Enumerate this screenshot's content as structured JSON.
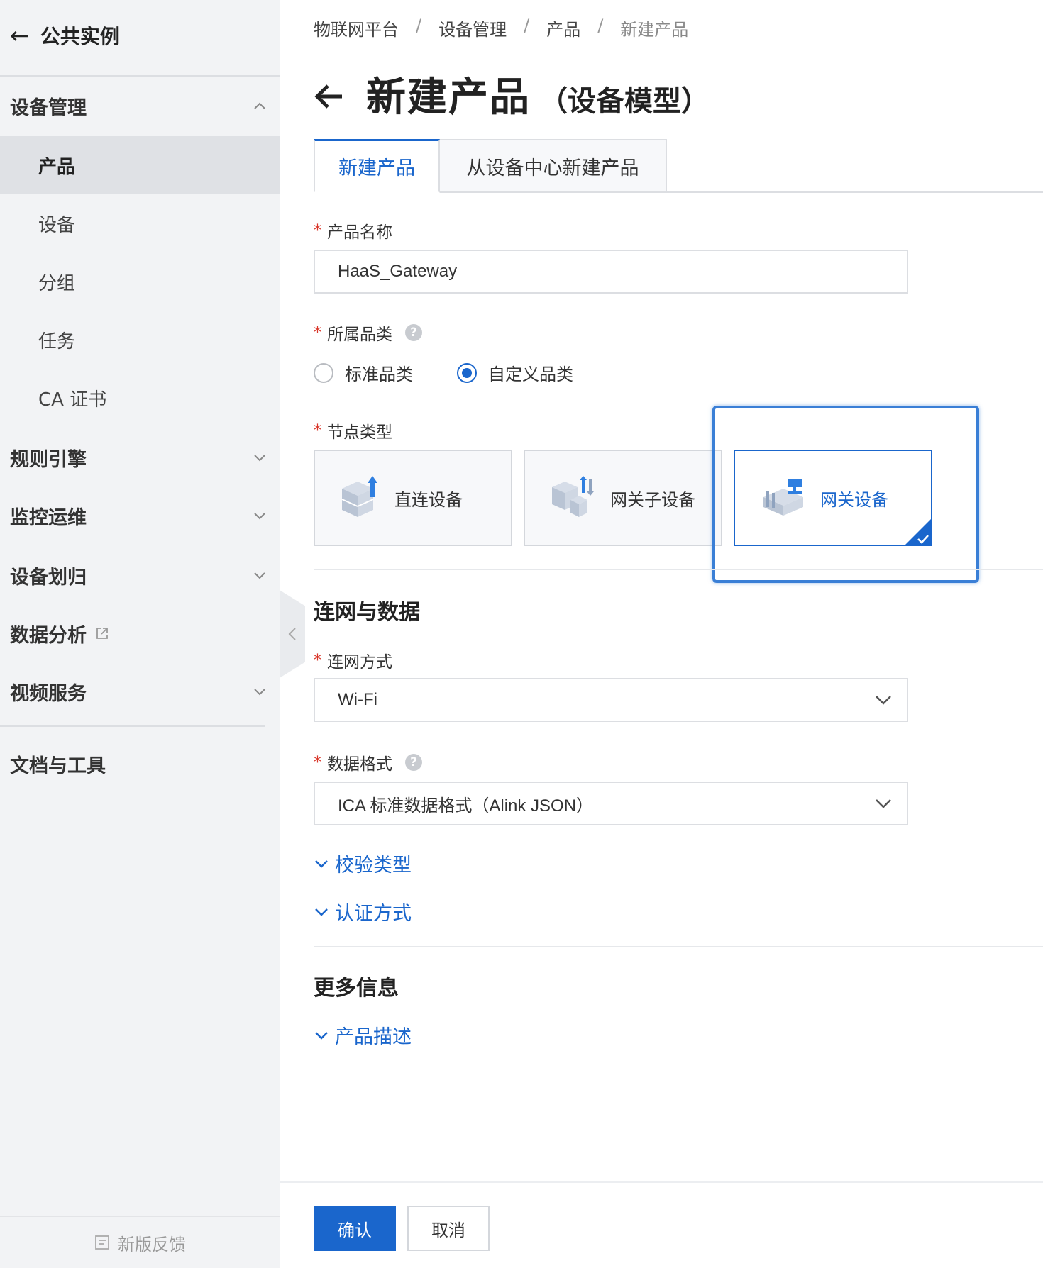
{
  "sidebar": {
    "back_label": "公共实例",
    "groups": {
      "device_mgmt": "设备管理",
      "rules": "规则引擎",
      "monitoring": "监控运维",
      "device_assign": "设备划归",
      "data_analysis": "数据分析",
      "video": "视频服务",
      "docs": "文档与工具"
    },
    "items": [
      "产品",
      "设备",
      "分组",
      "任务",
      "CA 证书"
    ],
    "feedback": "新版反馈"
  },
  "breadcrumb": [
    "物联网平台",
    "设备管理",
    "产品",
    "新建产品"
  ],
  "breadcrumb_sep": "/",
  "title": {
    "main": "新建产品",
    "sub": "（设备模型）"
  },
  "tabs": [
    "新建产品",
    "从设备中心新建产品"
  ],
  "form": {
    "required_mark": "*",
    "product_name_label": "产品名称",
    "product_name_value": "HaaS_Gateway",
    "category_label": "所属品类",
    "help_mark": "?",
    "category_options": [
      "标准品类",
      "自定义品类"
    ],
    "node_type_label": "节点类型",
    "node_types": [
      "直连设备",
      "网关子设备",
      "网关设备"
    ],
    "network_section": "连网与数据",
    "network_label": "连网方式",
    "network_value": "Wi-Fi",
    "data_format_label": "数据格式",
    "data_format_value": "ICA 标准数据格式（Alink JSON）",
    "verify_type": "校验类型",
    "auth_method": "认证方式",
    "more_section": "更多信息",
    "product_desc": "产品描述"
  },
  "buttons": {
    "confirm": "确认",
    "cancel": "取消"
  },
  "colors": {
    "accent": "#1a66cc",
    "required": "#d9372b",
    "highlight": "#3a7fd6"
  }
}
